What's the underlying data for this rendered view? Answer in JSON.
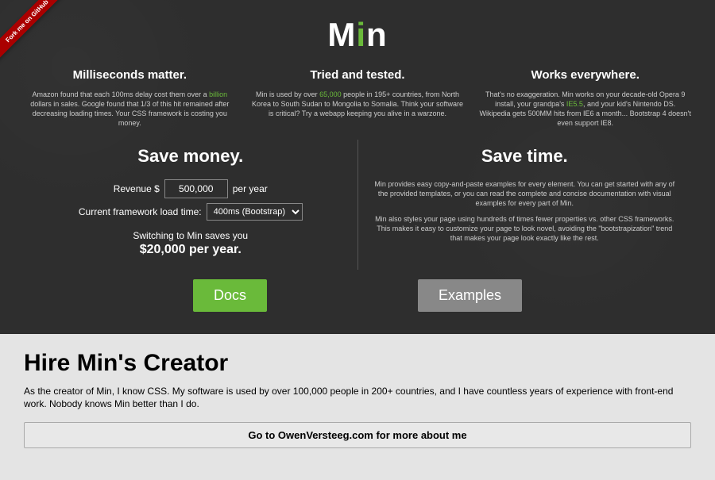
{
  "ribbon": {
    "text": "Fork me on GitHub"
  },
  "logo": {
    "prefix": "M",
    "suffix": "n"
  },
  "columns": {
    "c1": {
      "heading": "Milliseconds matter.",
      "text_before": "Amazon found that each 100ms delay cost them over a ",
      "highlight": "billion",
      "text_after": " dollars in sales. Google found that 1/3 of this hit remained after decreasing loading times. Your CSS framework is costing you money."
    },
    "c2": {
      "heading": "Tried and tested.",
      "text_before": "Min is used by over ",
      "highlight": "65,000",
      "text_after": " people in 195+ countries, from North Korea to South Sudan to Mongolia to Somalia. Think your software is critical? Try a webapp keeping you alive in a warzone."
    },
    "c3": {
      "heading": "Works everywhere.",
      "text_before": "That's no exaggeration. Min works on your decade-old Opera 9 install, your grandpa's ",
      "highlight": "IE5.5",
      "text_after": ", and your kid's Nintendo DS. Wikipedia gets 500MM hits from IE6 a month... Bootstrap 4 doesn't even support IE8."
    }
  },
  "save_money": {
    "heading": "Save money.",
    "revenue_label": "Revenue $",
    "revenue_value": "500,000",
    "revenue_suffix": "per year",
    "framework_label": "Current framework load time:",
    "framework_value": "400ms (Bootstrap)",
    "result_line": "Switching to Min saves you",
    "result_bold": "$20,000 per year."
  },
  "save_time": {
    "heading": "Save time.",
    "p1": "Min provides easy copy-and-paste examples for every element. You can get started with any of the provided templates, or you can read the complete and concise documentation with visual examples for every part of Min.",
    "p2": "Min also styles your page using hundreds of times fewer properties vs. other CSS frameworks. This makes it easy to customize your page to look novel, avoiding the \"bootstrapization\" trend that makes your page look exactly like the rest."
  },
  "buttons": {
    "docs": "Docs",
    "examples": "Examples"
  },
  "hire": {
    "heading": "Hire Min's Creator",
    "body": "As the creator of Min, I know CSS. My software is used by over 100,000 people in 200+ countries, and I have countless years of experience with front-end work. Nobody knows Min better than I do.",
    "cta": "Go to OwenVersteeg.com for more about me"
  }
}
